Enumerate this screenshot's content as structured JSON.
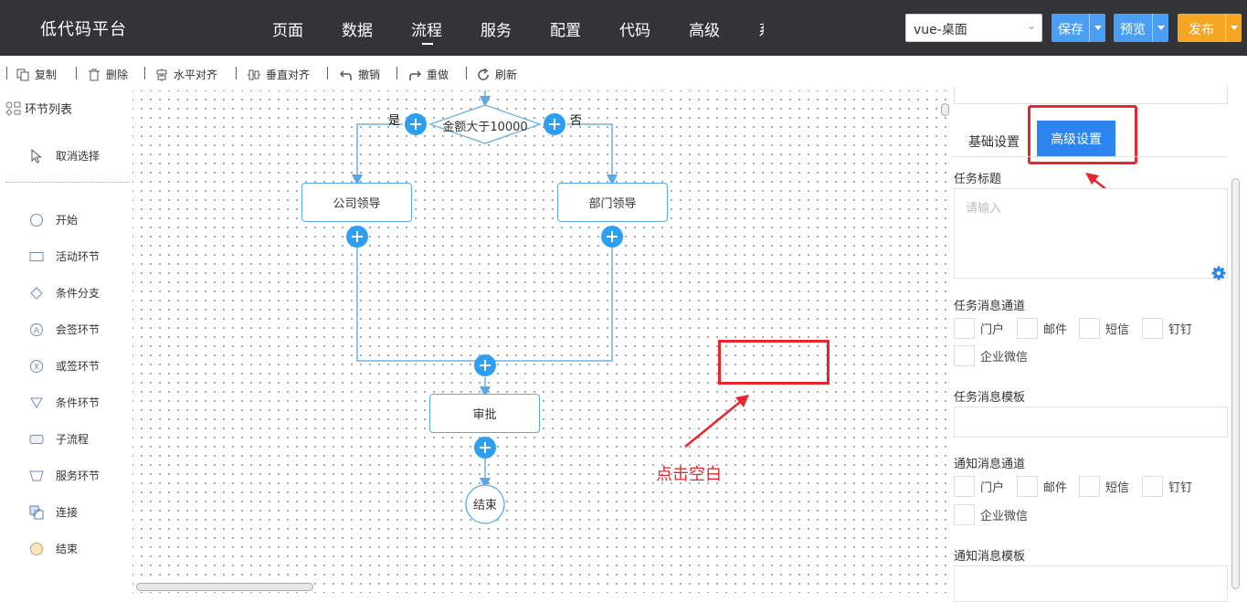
{
  "app": {
    "title": "低代码平台"
  },
  "nav": {
    "items": [
      "页面",
      "数据",
      "流程",
      "服务",
      "配置",
      "代码",
      "高级",
      "系"
    ],
    "active": "流程"
  },
  "header": {
    "env_select": "vue-桌面",
    "save_label": "保存",
    "preview_label": "预览",
    "publish_label": "发布",
    "colors": {
      "save": "#4a9ff5",
      "preview": "#4a9ff5",
      "publish": "#f5a623",
      "bar": "#333437"
    }
  },
  "toolbar": {
    "copy": "复制",
    "delete": "删除",
    "halign": "水平对齐",
    "valign": "垂直对齐",
    "undo": "撤销",
    "redo": "重做",
    "refresh": "刷新"
  },
  "left_panel": {
    "title": "环节列表",
    "deselect": "取消选择",
    "items": [
      {
        "label": "开始",
        "icon": "circle-icon"
      },
      {
        "label": "活动环节",
        "icon": "rectangle-icon"
      },
      {
        "label": "条件分支",
        "icon": "diamond-icon"
      },
      {
        "label": "会签环节",
        "icon": "countersign-icon"
      },
      {
        "label": "或签环节",
        "icon": "or-sign-icon"
      },
      {
        "label": "条件环节",
        "icon": "triangle-icon"
      },
      {
        "label": "子流程",
        "icon": "rounded-rect-icon"
      },
      {
        "label": "服务环节",
        "icon": "trapezoid-icon"
      },
      {
        "label": "连接",
        "icon": "connect-icon"
      },
      {
        "label": "结束",
        "icon": "end-circle-icon"
      }
    ]
  },
  "flow": {
    "condition": "金额大于10000",
    "yes": "是",
    "no": "否",
    "company_leader": "公司领导",
    "dept_leader": "部门领导",
    "approve": "审批",
    "end": "结束",
    "annotation": "点击空白"
  },
  "right_panel": {
    "tabs": [
      "基础设置",
      "高级设置"
    ],
    "active_tab": "高级设置",
    "task_title_label": "任务标题",
    "task_title_placeholder": "请输入",
    "task_channel_label": "任务消息通道",
    "channels": [
      "门户",
      "邮件",
      "短信",
      "钉钉",
      "企业微信"
    ],
    "task_template_label": "任务消息模板",
    "notify_channel_label": "通知消息通道",
    "notify_template_label": "通知消息模板"
  }
}
